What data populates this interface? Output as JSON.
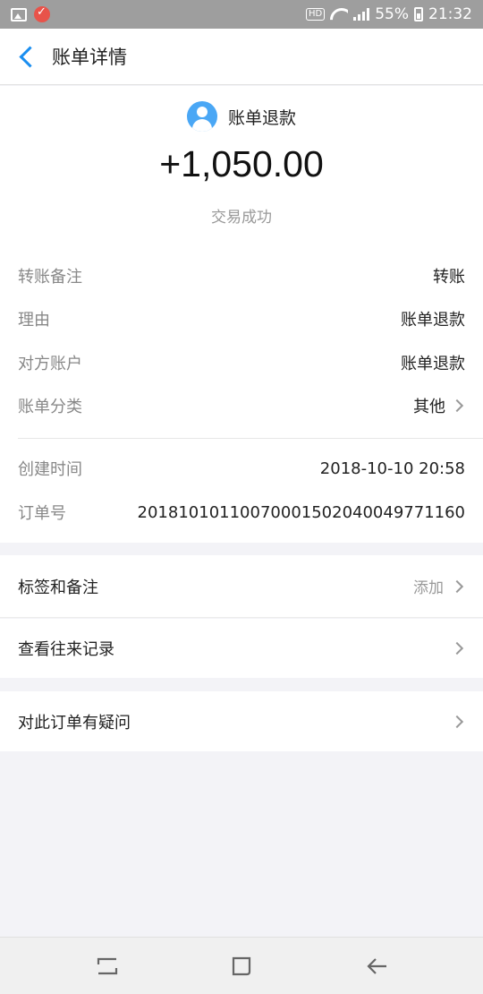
{
  "status_bar": {
    "battery": "55%",
    "time": "21:32",
    "hd_label": "HD"
  },
  "nav": {
    "title": "账单详情"
  },
  "summary": {
    "counterparty": "账单退款",
    "amount": "+1,050.00",
    "status": "交易成功"
  },
  "details": [
    {
      "label": "转账备注",
      "value": "转账"
    },
    {
      "label": "理由",
      "value": "账单退款"
    },
    {
      "label": "对方账户",
      "value": "账单退款"
    },
    {
      "label": "账单分类",
      "value": "其他"
    }
  ],
  "info": [
    {
      "label": "创建时间",
      "value": "2018-10-10 20:58"
    },
    {
      "label": "订单号",
      "value": "20181010110070001502040049771160"
    }
  ],
  "actions": {
    "tags": {
      "label": "标签和备注",
      "hint": "添加"
    },
    "history": {
      "label": "查看往来记录"
    },
    "question": {
      "label": "对此订单有疑问"
    }
  },
  "colors": {
    "accent": "#1a8ef0",
    "avatar": "#4aa7f5",
    "page_bg": "#f3f3f7"
  }
}
